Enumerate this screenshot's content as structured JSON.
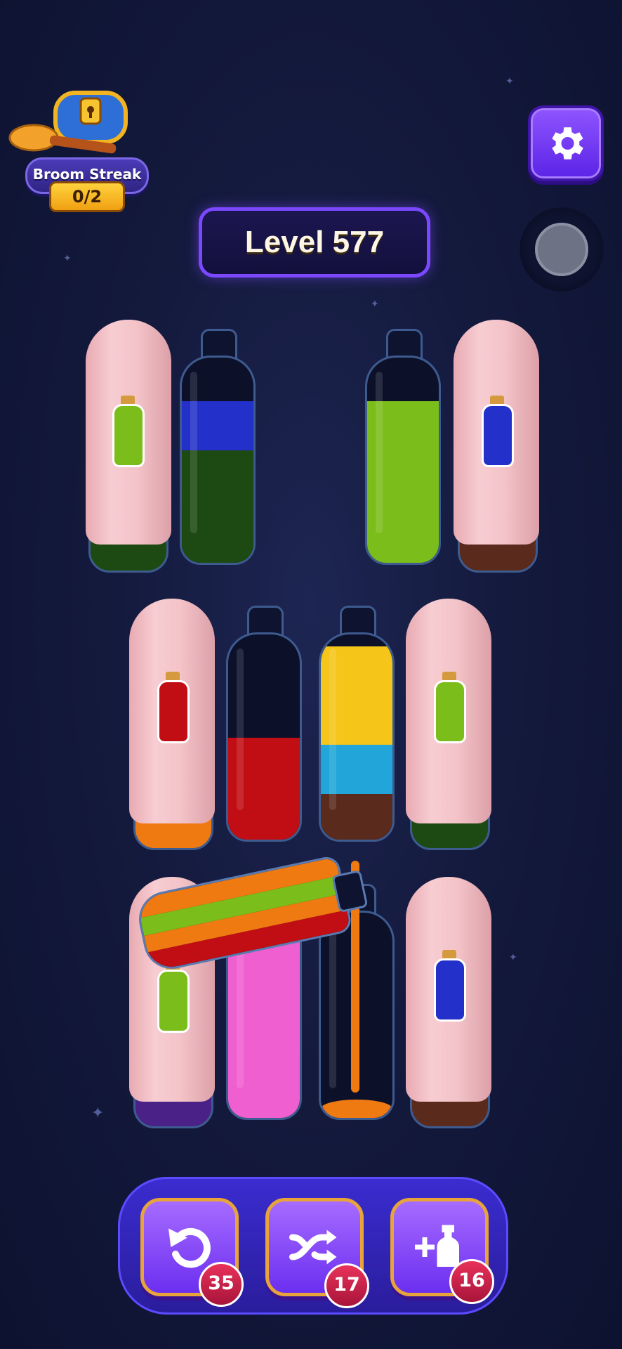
{
  "streak": {
    "label": "Broom Streak",
    "count": "0/2"
  },
  "level": {
    "label": "Level 577"
  },
  "colors": {
    "blue": "#2330c9",
    "dark_green": "#1d4a12",
    "lime": "#7bbd1a",
    "red": "#c10d14",
    "yellow": "#f5c51a",
    "cyan": "#22a5d8",
    "brown": "#5a2a1c",
    "pink": "#ef5fcf",
    "orange": "#f07a12",
    "purple": "#4a2287"
  },
  "controls": {
    "undo_count": "35",
    "shuffle_count": "17",
    "add_bottle_count": "16"
  },
  "bottles": [
    {
      "id": "r1-hidden-left",
      "hidden": true,
      "hint": "lime",
      "base": "dark_green"
    },
    {
      "id": "r1-open-left",
      "layers_bottom_to_top": [
        "dark_green",
        "blue"
      ]
    },
    {
      "id": "r1-open-right",
      "layers_bottom_to_top": [
        "lime"
      ]
    },
    {
      "id": "r1-hidden-right",
      "hidden": true,
      "hint": "blue",
      "base": "brown"
    },
    {
      "id": "r2-hidden-left",
      "hidden": true,
      "hint": "red",
      "base": "orange"
    },
    {
      "id": "r2-open-left",
      "layers_bottom_to_top": [
        "red"
      ]
    },
    {
      "id": "r2-open-right",
      "layers_bottom_to_top": [
        "brown",
        "cyan",
        "yellow"
      ]
    },
    {
      "id": "r2-hidden-right",
      "hidden": true,
      "hint": "lime",
      "base": "dark_green"
    },
    {
      "id": "r3-hidden-left",
      "hidden": true,
      "hint": "lime",
      "base": "purple"
    },
    {
      "id": "r3-open-left",
      "layers_bottom_to_top": [
        "pink"
      ]
    },
    {
      "id": "r3-open-right",
      "layers_bottom_to_top": [
        "orange"
      ]
    },
    {
      "id": "r3-hidden-right",
      "hidden": true,
      "hint": "blue",
      "base": "brown"
    },
    {
      "id": "pouring",
      "layers_bottom_to_top": [
        "red",
        "orange",
        "lime",
        "orange"
      ]
    }
  ]
}
